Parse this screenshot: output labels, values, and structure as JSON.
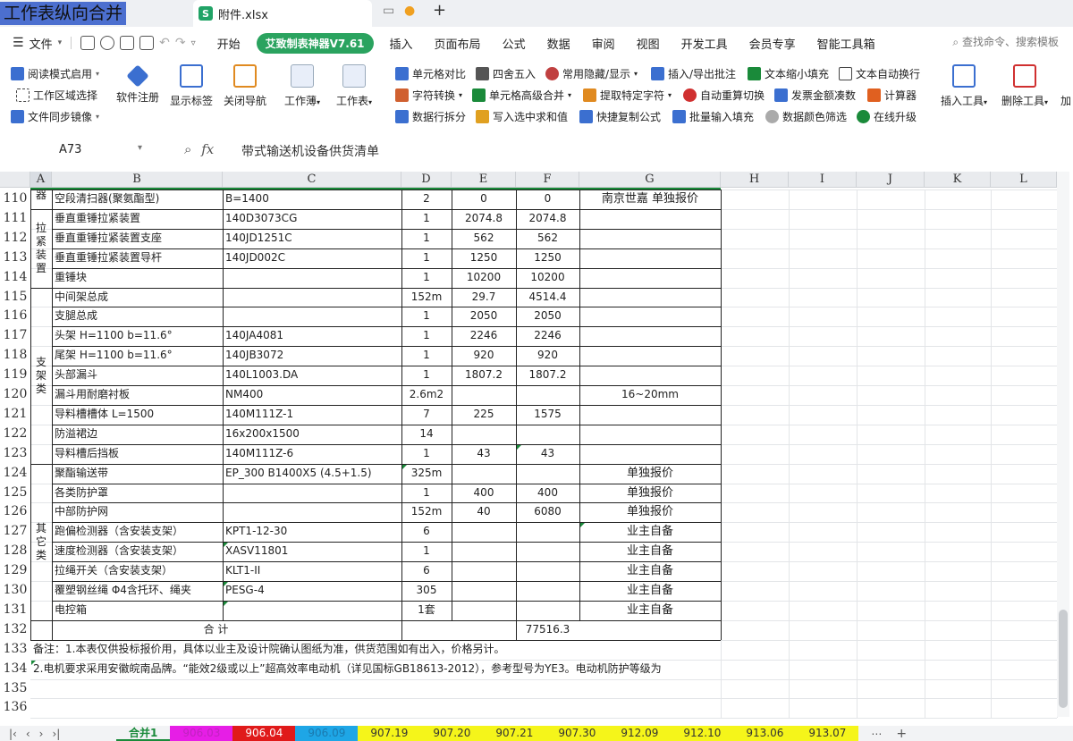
{
  "window": {
    "overlay_title": "工作表纵向合并",
    "doc_tab": "附件.xlsx",
    "new_tab": "+"
  },
  "menu": {
    "file": "文件",
    "items": [
      "开始",
      "插入",
      "页面布局",
      "公式",
      "数据",
      "审阅",
      "视图",
      "开发工具",
      "会员专享",
      "智能工具箱"
    ],
    "addon": "艾致制表神器V7.61",
    "search": "查找命令、搜索模板"
  },
  "ribbon": {
    "col1": [
      "阅读模式启用",
      "工作区域选择",
      "文件同步镜像"
    ],
    "big": [
      "软件注册",
      "显示标签",
      "关闭导航",
      "工作薄",
      "工作表"
    ],
    "grid_a": [
      "单元格对比",
      "字符转换",
      "数据行拆分"
    ],
    "grid_b": [
      "四舍五入",
      "单元格高级合并",
      "写入选中求和值"
    ],
    "grid_c": [
      "常用隐藏/显示",
      "提取特定字符",
      "快捷复制公式"
    ],
    "grid_d": [
      "插入/导出批注",
      "自动重算切换",
      "批量输入填充"
    ],
    "grid_e": [
      "文本缩小填充",
      "发票金额凑数",
      "数据颜色筛选"
    ],
    "grid_f": [
      "文本自动换行",
      "计算器",
      "在线升级"
    ],
    "right_big": [
      "插入工具",
      "删除工具",
      "加"
    ]
  },
  "formula": {
    "name_box": "A73",
    "fx": "fx",
    "content": "带式输送机设备供货清单"
  },
  "columns": [
    "A",
    "B",
    "C",
    "D",
    "E",
    "F",
    "G",
    "H",
    "I",
    "J",
    "K",
    "L"
  ],
  "rows": [
    {
      "n": "110",
      "b": "空段清扫器(聚氨酯型)",
      "c": "B=1400",
      "d": "2",
      "e": "0",
      "f": "0",
      "g": "南京世嘉 单独报价"
    },
    {
      "n": "111",
      "b": "垂直重锤拉紧装置",
      "c": "140D3073CG",
      "d": "1",
      "e": "2074.8",
      "f": "2074.8",
      "g": ""
    },
    {
      "n": "112",
      "b": "垂直重锤拉紧装置支座",
      "c": "140JD1251C",
      "d": "1",
      "e": "562",
      "f": "562",
      "g": ""
    },
    {
      "n": "113",
      "b": "垂直重锤拉紧装置导杆",
      "c": "140JD002C",
      "d": "1",
      "e": "1250",
      "f": "1250",
      "g": ""
    },
    {
      "n": "114",
      "b": "重锤块",
      "c": "",
      "d": "1",
      "e": "10200",
      "f": "10200",
      "g": ""
    },
    {
      "n": "115",
      "b": "中间架总成",
      "c": "",
      "d": "152m",
      "e": "29.7",
      "f": "4514.4",
      "g": ""
    },
    {
      "n": "116",
      "b": "支腿总成",
      "c": "",
      "d": "1",
      "e": "2050",
      "f": "2050",
      "g": ""
    },
    {
      "n": "117",
      "b": "头架  H=1100 b=11.6°",
      "c": "140JA4081",
      "d": "1",
      "e": "2246",
      "f": "2246",
      "g": ""
    },
    {
      "n": "118",
      "b": "尾架  H=1100 b=11.6°",
      "c": "140JB3072",
      "d": "1",
      "e": "920",
      "f": "920",
      "g": ""
    },
    {
      "n": "119",
      "b": "头部漏斗",
      "c": "140L1003.DA",
      "d": "1",
      "e": "1807.2",
      "f": "1807.2",
      "g": ""
    },
    {
      "n": "120",
      "b": "漏斗用耐磨衬板",
      "c": "NM400",
      "d": "2.6m2",
      "e": "",
      "f": "",
      "g": "16~20mm"
    },
    {
      "n": "121",
      "b": "导料槽槽体  L=1500",
      "c": "140M111Z-1",
      "d": "7",
      "e": "225",
      "f": "1575",
      "g": ""
    },
    {
      "n": "122",
      "b": "防溢裙边",
      "c": "16x200x1500",
      "d": "14",
      "e": "",
      "f": "",
      "g": ""
    },
    {
      "n": "123",
      "b": "导料槽后挡板",
      "c": "140M111Z-6",
      "d": "1",
      "e": "43",
      "f": "43",
      "g": ""
    },
    {
      "n": "124",
      "b": "聚酯输送带",
      "c": "EP_300 B1400X5 (4.5+1.5)",
      "d": "325m",
      "e": "",
      "f": "",
      "g": "单独报价"
    },
    {
      "n": "125",
      "b": "各类防护罩",
      "c": "",
      "d": "1",
      "e": "400",
      "f": "400",
      "g": "单独报价"
    },
    {
      "n": "126",
      "b": "中部防护网",
      "c": "",
      "d": "152m",
      "e": "40",
      "f": "6080",
      "g": "单独报价"
    },
    {
      "n": "127",
      "b": "跑偏检测器（含安装支架）",
      "c": "KPT1-12-30",
      "d": "6",
      "e": "",
      "f": "",
      "g": "业主自备"
    },
    {
      "n": "128",
      "b": "速度检测器（含安装支架）",
      "c": "XASV11801",
      "d": "1",
      "e": "",
      "f": "",
      "g": "业主自备"
    },
    {
      "n": "129",
      "b": "拉绳开关（含安装支架）",
      "c": "KLT1-II",
      "d": "6",
      "e": "",
      "f": "",
      "g": "业主自备"
    },
    {
      "n": "130",
      "b": "覆塑钢丝绳 Φ4含托环、绳夹",
      "c": "PESG-4",
      "d": "305",
      "e": "",
      "f": "",
      "g": "业主自备"
    },
    {
      "n": "131",
      "b": "电控箱",
      "c": "",
      "d": "1套",
      "e": "",
      "f": "",
      "g": "业主自备"
    }
  ],
  "total_row": {
    "n": "132",
    "label": "合          计",
    "f": "77516.3"
  },
  "note_rows": [
    {
      "n": "133",
      "text": "备注：1.本表仅供投标报价用，具体以业主及设计院确认图纸为准，供货范围如有出入，价格另计。"
    },
    {
      "n": "134",
      "text": "  2.电机要求采用安徽皖南品牌。“能效2级或以上”超高效率电动机（详见国标GB18613-2012），参考型号为YE3。电动机防护等级为"
    }
  ],
  "empty_rows": [
    "135",
    "136"
  ],
  "group_labels": {
    "top": "器",
    "tension": "拉紧装置",
    "support": "支架类",
    "other": "其它类"
  },
  "sheet_tabs": [
    {
      "label": "合并1",
      "color": "#f2f3f5",
      "text": "#1a8a3a"
    },
    {
      "label": "906.03",
      "color": "#e61ee6",
      "text": "#c022c0"
    },
    {
      "label": "906.04",
      "color": "#e01a1a",
      "text": "#ffffff"
    },
    {
      "label": "906.09",
      "color": "#1ea6e6",
      "text": "#1a7ab0"
    },
    {
      "label": "907.19",
      "color": "#f5f51a",
      "text": "#333333"
    },
    {
      "label": "907.20",
      "color": "#f5f51a",
      "text": "#333333"
    },
    {
      "label": "907.21",
      "color": "#f5f51a",
      "text": "#333333"
    },
    {
      "label": "907.30",
      "color": "#f5f51a",
      "text": "#333333"
    },
    {
      "label": "912.09",
      "color": "#f5f51a",
      "text": "#333333"
    },
    {
      "label": "912.10",
      "color": "#f5f51a",
      "text": "#333333"
    },
    {
      "label": "913.06",
      "color": "#f5f51a",
      "text": "#333333"
    },
    {
      "label": "913.07",
      "color": "#f5f51a",
      "text": "#333333"
    }
  ]
}
